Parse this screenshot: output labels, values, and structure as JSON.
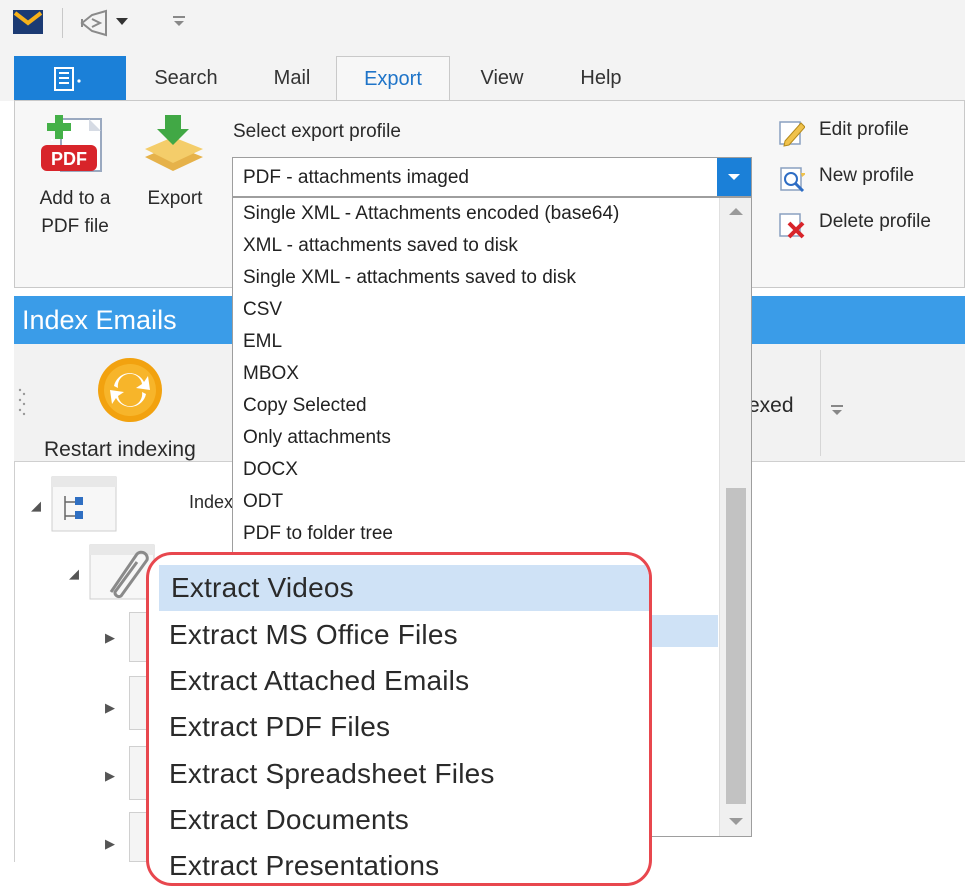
{
  "tabs": [
    {
      "label": "Search"
    },
    {
      "label": "Mail"
    },
    {
      "label": "Export"
    },
    {
      "label": "View"
    },
    {
      "label": "Help"
    }
  ],
  "ribbon": {
    "add_pdf_label_1": "Add to a",
    "add_pdf_label_2": "PDF file",
    "pdf_badge": "PDF",
    "export_label": "Export",
    "select_profile_label": "Select export profile",
    "edit_profile": "Edit profile",
    "new_profile": "New profile",
    "delete_profile": "Delete profile"
  },
  "combo": {
    "selected": "PDF - attachments imaged"
  },
  "dropdown": {
    "items": [
      "Single XML - Attachments encoded (base64)",
      "XML - attachments saved to disk",
      "Single XML - attachments saved to disk",
      "CSV",
      "EML",
      "MBOX",
      "Copy Selected",
      "Only attachments",
      "DOCX",
      "ODT",
      "PDF to folder tree"
    ]
  },
  "index_panel": {
    "title": "Index Emails",
    "restart_label": "Restart indexing",
    "partial_label": "exed",
    "tree_partial_label": "Index"
  },
  "zoom_list": {
    "items": [
      "Extract Videos",
      "Extract MS Office Files",
      "Extract Attached Emails",
      "Extract PDF Files",
      "Extract Spreadsheet Files",
      "Extract Documents",
      "Extract Presentations"
    ],
    "selected_index": 0
  },
  "colors": {
    "accent": "#1b80d8",
    "header_blue": "#3a9ce8",
    "selection": "#cfe2f6",
    "callout_border": "#e8474e"
  }
}
